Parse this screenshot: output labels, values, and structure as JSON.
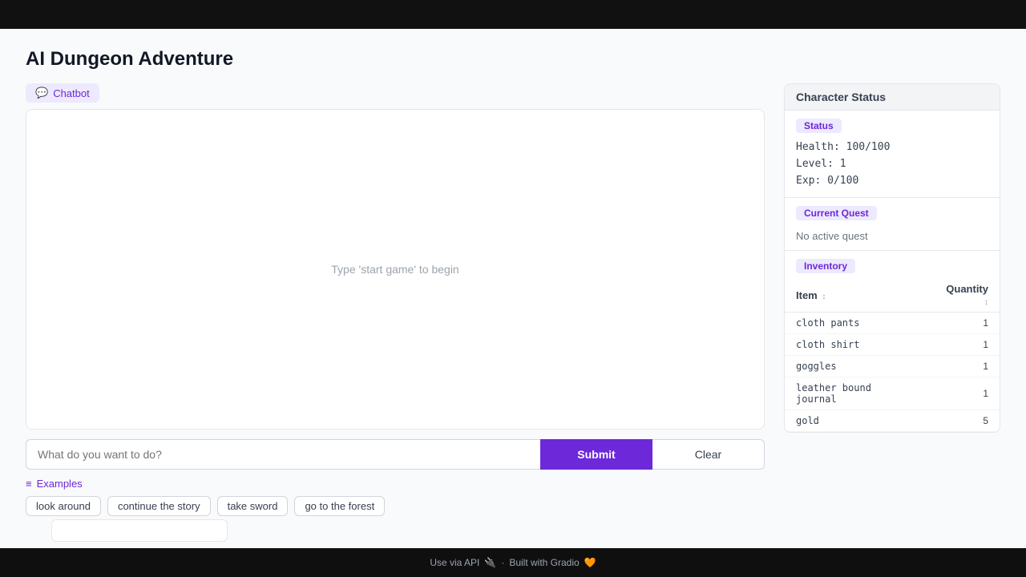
{
  "topbar": {},
  "page": {
    "title": "AI Dungeon Adventure"
  },
  "chatbot": {
    "tab_label": "Chatbot",
    "tab_icon": "💬",
    "placeholder_text": "Type 'start game' to begin",
    "input_placeholder": "What do you want to do?"
  },
  "toolbar": {
    "submit_label": "Submit",
    "clear_label": "Clear"
  },
  "examples": {
    "header": "Examples",
    "pills": [
      {
        "label": "look around"
      },
      {
        "label": "continue the story"
      },
      {
        "label": "take sword"
      },
      {
        "label": "go to the forest"
      }
    ]
  },
  "character_status": {
    "title": "Character Status",
    "status_label": "Status",
    "health": "Health: 100/100",
    "level": "Level: 1",
    "exp": "Exp: 0/100",
    "quest_label": "Current Quest",
    "no_quest": "No active quest",
    "inventory_label": "Inventory",
    "inventory_columns": {
      "item": "Item",
      "quantity": "Quantity"
    },
    "inventory_items": [
      {
        "item": "cloth pants",
        "qty": "1"
      },
      {
        "item": "cloth shirt",
        "qty": "1"
      },
      {
        "item": "goggles",
        "qty": "1"
      },
      {
        "item": "leather bound journal",
        "qty": "1"
      },
      {
        "item": "gold",
        "qty": "5"
      }
    ]
  },
  "footer": {
    "api_text": "Use via API",
    "api_icon": "🔌",
    "separator": "·",
    "built_text": "Built with Gradio",
    "built_icon": "🧡"
  }
}
